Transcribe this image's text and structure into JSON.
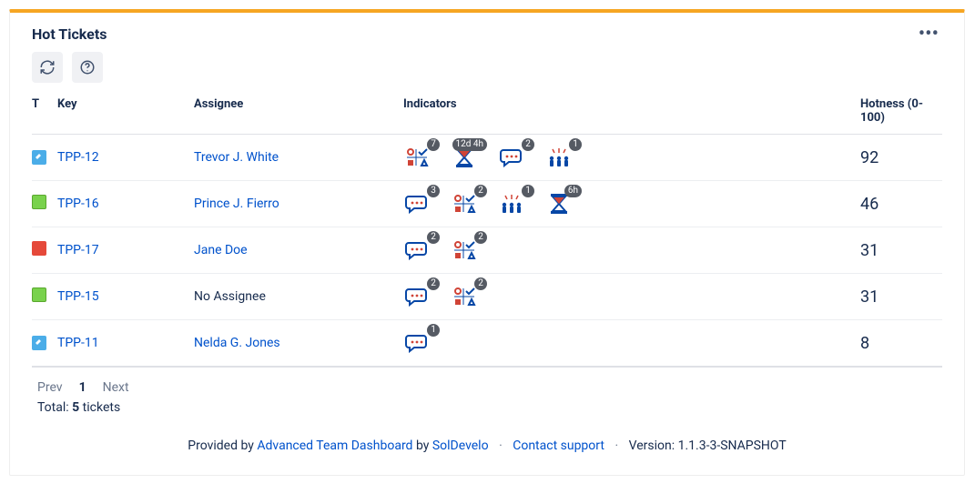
{
  "header": {
    "title": "Hot Tickets"
  },
  "columns": {
    "t": "T",
    "key": "Key",
    "assignee": "Assignee",
    "indicators": "Indicators",
    "hotness": "Hotness (0-100)"
  },
  "rows": [
    {
      "type": "blue",
      "key": "TPP-12",
      "assignee": "Trevor J. White",
      "assignee_link": true,
      "hotness": "92",
      "indicators": [
        {
          "icon": "icons",
          "badge": "7"
        },
        {
          "icon": "hourglass",
          "badge": "12d 4h"
        },
        {
          "icon": "comments",
          "badge": "2"
        },
        {
          "icon": "participants",
          "badge": "1"
        }
      ]
    },
    {
      "type": "green",
      "key": "TPP-16",
      "assignee": "Prince J. Fierro",
      "assignee_link": true,
      "hotness": "46",
      "indicators": [
        {
          "icon": "comments",
          "badge": "3"
        },
        {
          "icon": "icons",
          "badge": "2"
        },
        {
          "icon": "participants",
          "badge": "1"
        },
        {
          "icon": "hourglass",
          "badge": "6h"
        }
      ]
    },
    {
      "type": "red",
      "key": "TPP-17",
      "assignee": "Jane Doe",
      "assignee_link": true,
      "hotness": "31",
      "indicators": [
        {
          "icon": "comments",
          "badge": "2"
        },
        {
          "icon": "icons",
          "badge": "2"
        }
      ]
    },
    {
      "type": "green",
      "key": "TPP-15",
      "assignee": "No Assignee",
      "assignee_link": false,
      "hotness": "31",
      "indicators": [
        {
          "icon": "comments",
          "badge": "2"
        },
        {
          "icon": "icons",
          "badge": "2"
        }
      ]
    },
    {
      "type": "blue",
      "key": "TPP-11",
      "assignee": "Nelda G. Jones",
      "assignee_link": true,
      "hotness": "8",
      "indicators": [
        {
          "icon": "comments",
          "badge": "1"
        }
      ]
    }
  ],
  "pager": {
    "prev": "Prev",
    "current": "1",
    "next": "Next"
  },
  "totals": {
    "label_total": "Total:",
    "count": "5",
    "label_tickets": "tickets"
  },
  "footer": {
    "provided_by": "Provided by",
    "product": "Advanced Team Dashboard",
    "by": "by",
    "vendor": "SolDevelo",
    "contact": "Contact support",
    "version_label": "Version:",
    "version": "1.1.3-3-SNAPSHOT"
  }
}
